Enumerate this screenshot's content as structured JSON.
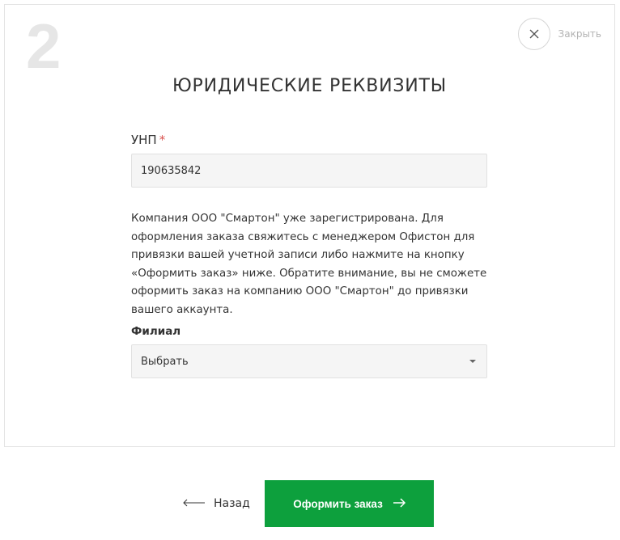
{
  "step": {
    "number": "2"
  },
  "close": {
    "label": "Закрыть",
    "icon": "close-icon"
  },
  "page": {
    "title": "ЮРИДИЧЕСКИЕ РЕКВИЗИТЫ"
  },
  "form": {
    "unp": {
      "label": "УНП",
      "required_mark": "*",
      "value": "190635842"
    },
    "notice": "Компания ООО \"Смартон\" уже зарегистрирована. Для оформления заказа свяжитесь с менеджером Офистон для привязки вашей учетной записи либо нажмите на кнопку «Оформить заказ» ниже. Обратите внимание, вы не сможете оформить заказ на компанию ООО \"Смартон\" до привязки вашего аккаунта.",
    "branch": {
      "label": "Филиал",
      "selected": "Выбрать"
    }
  },
  "footer": {
    "back_label": "Назад",
    "submit_label": "Оформить заказ"
  },
  "colors": {
    "accent": "#0da03d",
    "required": "#d9534f",
    "muted": "#b3b3b3",
    "step_number": "#e6e6e6"
  }
}
